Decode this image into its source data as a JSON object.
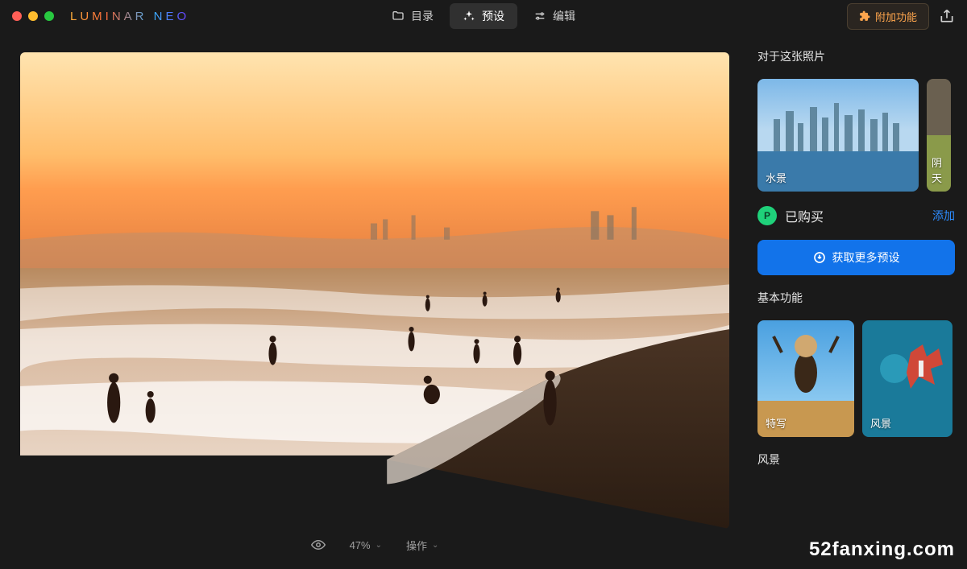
{
  "app": {
    "name": "LUMINAR NEO"
  },
  "tabs": {
    "catalog": "目录",
    "presets": "预设",
    "edit": "编辑"
  },
  "header": {
    "addon": "附加功能"
  },
  "viewer": {
    "zoom": "47%",
    "actions": "操作"
  },
  "panel": {
    "for_this_photo": "对于这张照片",
    "water_scene": "水景",
    "cloudy": "阴天",
    "purchased": "已购买",
    "add": "添加",
    "get_more": "获取更多预设",
    "basic_title": "基本功能",
    "featured": "特写",
    "landscape": "风景",
    "landscape_section": "风景"
  },
  "watermark": "52fanxing.com"
}
